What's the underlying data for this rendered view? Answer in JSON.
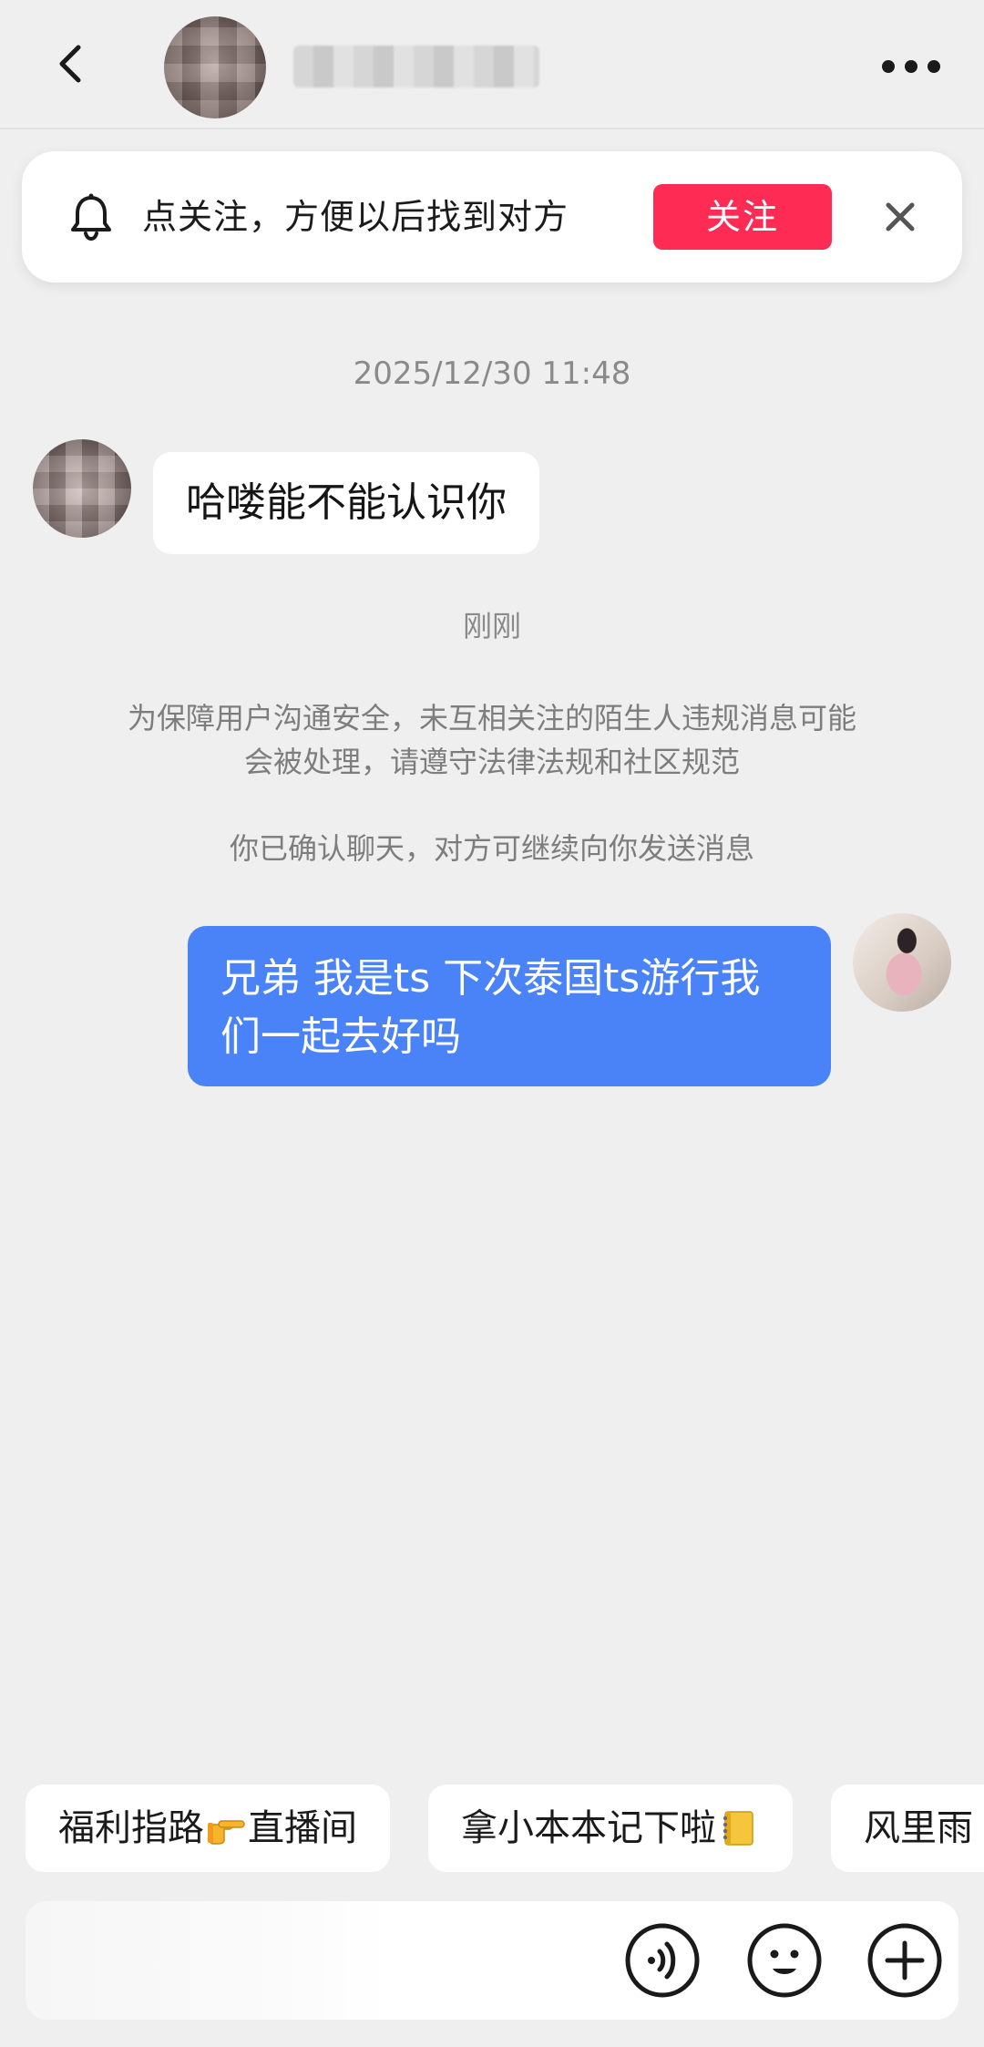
{
  "header": {
    "back_icon": "chevron-left-icon",
    "more_icon": "ellipsis-icon"
  },
  "follow_banner": {
    "icon": "bell-icon",
    "text": "点关注，方便以后找到对方",
    "button_label": "关注",
    "close_icon": "close-icon",
    "accent_color": "#fe2c55"
  },
  "chat": {
    "timestamp": "2025/12/30 11:48",
    "incoming_message": "哈喽能不能认识你",
    "sub_time": "刚刚",
    "safety_notice": "为保障用户沟通安全，未互相关注的陌生人违规消息可能会被处理，请遵守法律法规和社区规范",
    "confirm_notice": "你已确认聊天，对方可继续向你发送消息",
    "outgoing_message": "兄弟 我是ts 下次泰国ts游行我们一起去好吗",
    "outgoing_color": "#4a82f7"
  },
  "quick_replies": [
    {
      "before": "福利指路",
      "emoji": "pointing-hand-emoji",
      "after": "直播间"
    },
    {
      "before": "拿小本本记下啦",
      "emoji": "notebook-emoji",
      "after": ""
    },
    {
      "before": "风里雨",
      "emoji": "",
      "after": ""
    }
  ],
  "input_bar": {
    "voice_icon": "voice-icon",
    "emoji_icon": "emoji-face-icon",
    "plus_icon": "plus-icon"
  }
}
